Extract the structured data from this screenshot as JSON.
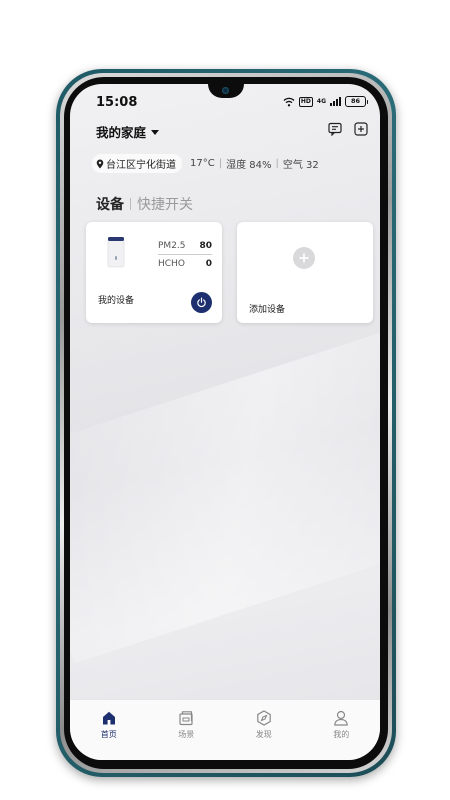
{
  "status_bar": {
    "time": "15:08",
    "hd": "HD",
    "network": "4G",
    "battery": "86"
  },
  "header": {
    "home_name": "我的家庭",
    "icons": [
      "message-icon",
      "add-icon"
    ]
  },
  "location": {
    "place": "台江区宁化街道",
    "temperature": "17°C",
    "humidity": "湿度 84%",
    "air": "空气 32"
  },
  "tabs": {
    "devices": "设备",
    "shortcuts": "快捷开关"
  },
  "device_card": {
    "readings": [
      {
        "label": "PM2.5",
        "value": "80"
      },
      {
        "label": "HCHO",
        "value": "0"
      }
    ],
    "name": "我的设备",
    "icon": "power-icon"
  },
  "add_card": {
    "label": "添加设备",
    "icon": "plus-icon"
  },
  "nav": {
    "items": [
      {
        "label": "首页",
        "icon": "home-icon"
      },
      {
        "label": "场景",
        "icon": "scene-icon"
      },
      {
        "label": "发现",
        "icon": "discover-icon"
      },
      {
        "label": "我的",
        "icon": "profile-icon"
      }
    ],
    "active_color": "#1d2f6e"
  }
}
